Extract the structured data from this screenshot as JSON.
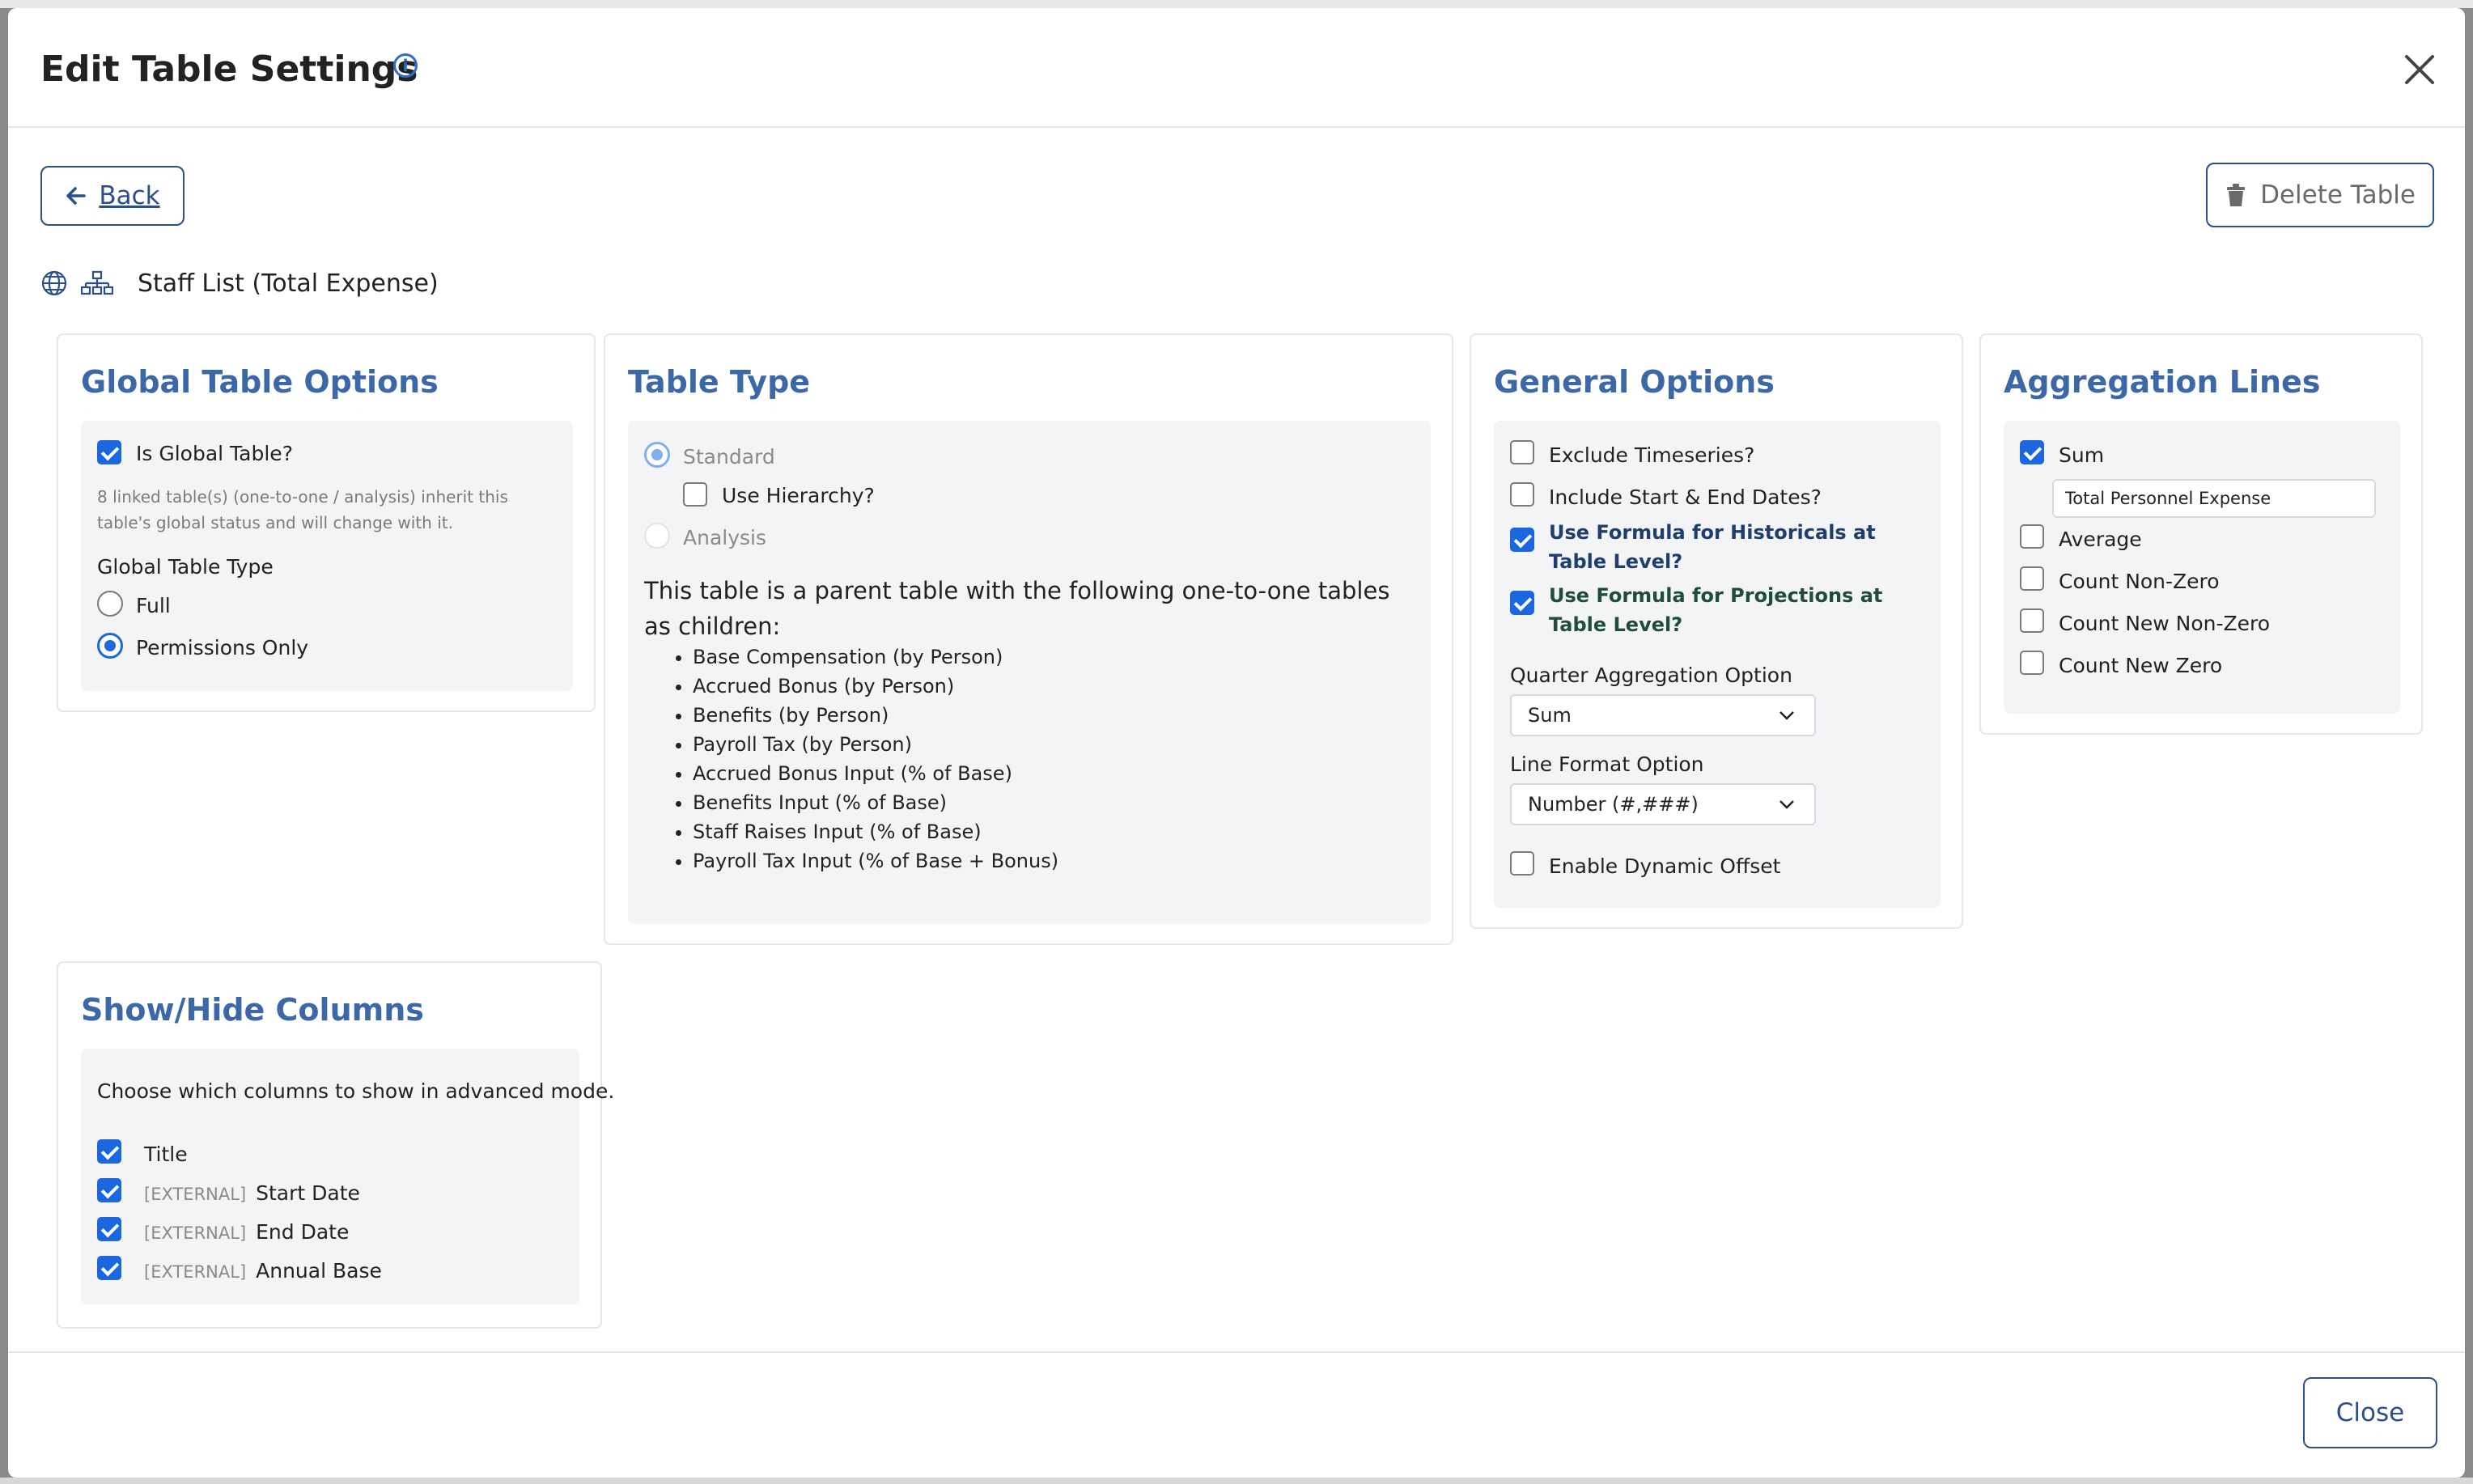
{
  "dialog": {
    "title": "Edit Table Settings",
    "back_label": "Back",
    "delete_label": "Delete Table",
    "close_label": "Close",
    "table_name": "Staff List (Total Expense)"
  },
  "global_options": {
    "title": "Global Table Options",
    "is_global_label": "Is Global Table?",
    "is_global_checked": true,
    "note": "8 linked table(s) (one-to-one / analysis) inherit this table's global status and will change with it.",
    "type_label": "Global Table Type",
    "types": [
      {
        "label": "Full",
        "selected": false
      },
      {
        "label": "Permissions Only",
        "selected": true
      }
    ]
  },
  "table_type": {
    "title": "Table Type",
    "standard_label": "Standard",
    "use_hierarchy_label": "Use Hierarchy?",
    "analysis_label": "Analysis",
    "description": "This table is a parent table with the following one-to-one tables as children:",
    "children": [
      "Base Compensation (by Person)",
      "Accrued Bonus (by Person)",
      "Benefits (by Person)",
      "Payroll Tax (by Person)",
      "Accrued Bonus Input (% of Base)",
      "Benefits Input (% of Base)",
      "Staff Raises Input (% of Base)",
      "Payroll Tax Input (% of Base + Bonus)"
    ]
  },
  "general_options": {
    "title": "General Options",
    "exclude_timeseries": "Exclude Timeseries?",
    "include_dates": "Include Start & End Dates?",
    "formula_historicals": "Use Formula for Historicals at Table Level?",
    "formula_projections": "Use Formula for Projections at Table Level?",
    "quarter_label": "Quarter Aggregation Option",
    "quarter_value": "Sum",
    "line_format_label": "Line Format Option",
    "line_format_value": "Number (#,###)",
    "dynamic_offset": "Enable Dynamic Offset"
  },
  "aggregation": {
    "title": "Aggregation Lines",
    "sum_label": "Sum",
    "sum_name_value": "Total Personnel Expense",
    "average_label": "Average",
    "count_non_zero": "Count Non-Zero",
    "count_new_non_zero": "Count New Non-Zero",
    "count_new_zero": "Count New Zero"
  },
  "columns": {
    "title": "Show/Hide Columns",
    "hint": "Choose which columns to show in advanced mode.",
    "external_tag": "[EXTERNAL]",
    "items": [
      "Title",
      "Start Date",
      "End Date",
      "Annual Base"
    ]
  },
  "colors": {
    "accent": "#1c66e0",
    "heading": "#3c68a8",
    "button_border": "#2b4f8c"
  }
}
